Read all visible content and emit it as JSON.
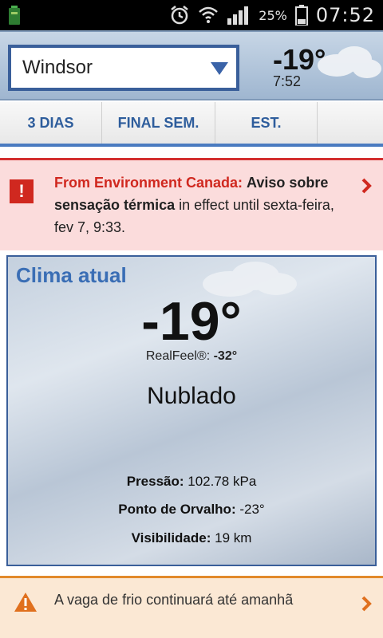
{
  "status_bar": {
    "battery_pct": "25%",
    "time": "07:52"
  },
  "header": {
    "city": "Windsor",
    "temperature": "-19°",
    "time": "7:52"
  },
  "tabs": [
    "3 DIAS",
    "FINAL SEM.",
    "EST.",
    ""
  ],
  "alert": {
    "source": "From Environment Canada:",
    "title": "Aviso sobre sensação térmica",
    "suffix": "in effect",
    "until": "until sexta-feira, fev 7, 9:33."
  },
  "current": {
    "title": "Clima atual",
    "temperature": "-19°",
    "realfeel_label": "RealFeel®:",
    "realfeel_value": "-32°",
    "condition": "Nublado",
    "details": [
      {
        "label": "Pressão:",
        "value": "102.78 kPa"
      },
      {
        "label": "Ponto de Orvalho:",
        "value": "-23°"
      },
      {
        "label": "Visibilidade:",
        "value": "19 km"
      }
    ]
  },
  "notice": {
    "text": "A vaga de frio continuará até amanhã"
  },
  "colors": {
    "accent_blue": "#3a6eb5",
    "alert_red": "#d0281f",
    "warning_orange": "#e28a2b"
  }
}
